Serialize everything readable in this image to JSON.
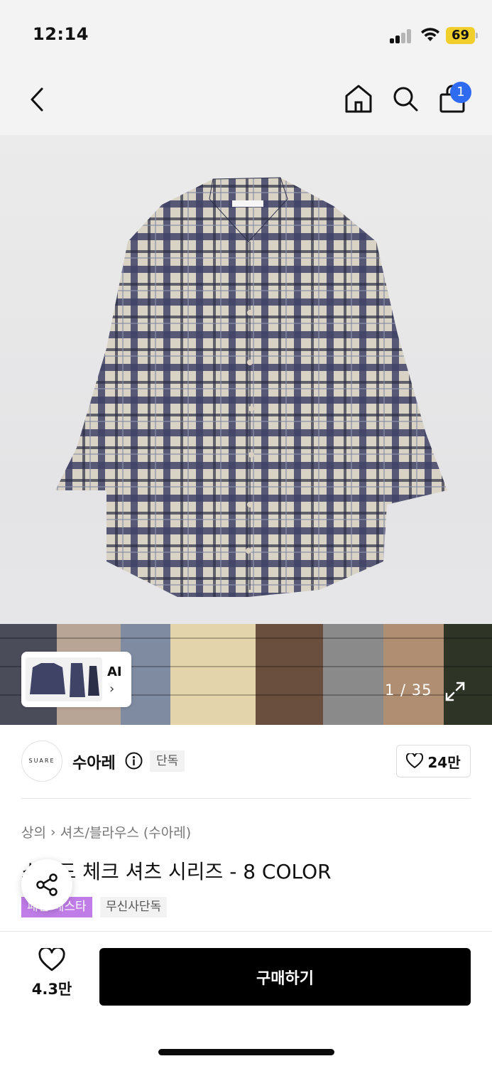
{
  "status_bar": {
    "time": "12:14",
    "battery": "69"
  },
  "nav": {
    "cart_count": "1"
  },
  "gallery": {
    "ai_label": "AI",
    "ai_chevron": "›",
    "counter": "1 / 35"
  },
  "brand": {
    "logo_text": "SUARE",
    "name": "수아레",
    "exclusive_badge": "단독",
    "like_count": "24만"
  },
  "breadcrumb": {
    "category": "상의",
    "separator": "›",
    "subcategory": "셔츠/블라우스 (수아레)"
  },
  "product": {
    "title": "스피드 체크 셔츠 시리즈 - 8 COLOR",
    "tags": [
      "패션 베스타",
      "무신사단독"
    ]
  },
  "bottom_bar": {
    "wish_count": "4.3만",
    "buy_label": "구매하기"
  },
  "colors": {
    "badge_blue": "#2f6bf0",
    "tag_purple": "#c07de8",
    "battery_yellow": "#f0cf2c",
    "buy_black": "#000000"
  },
  "icons": [
    "back-icon",
    "home-icon",
    "search-icon",
    "cart-icon",
    "expand-icon",
    "info-icon",
    "heart-icon",
    "share-icon"
  ]
}
